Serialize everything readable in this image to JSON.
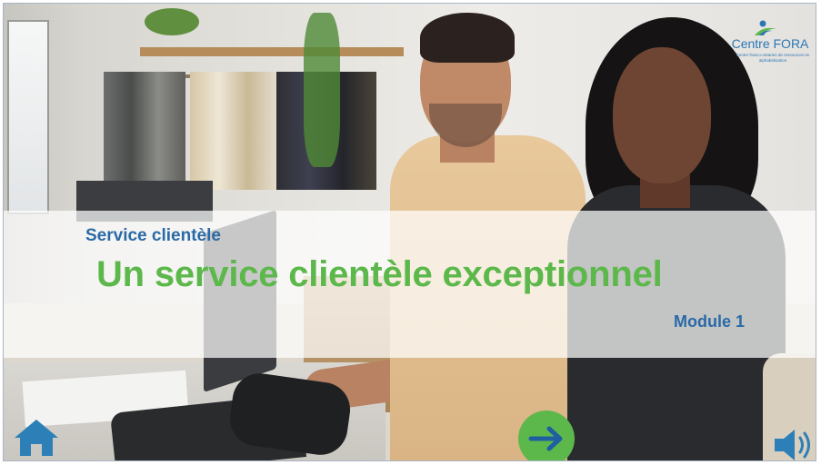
{
  "slide": {
    "category": "Service clientèle",
    "title": "Un service clientèle exceptionnel",
    "module": "Module 1"
  },
  "logo": {
    "name": "Centre FORA",
    "tagline": "Centre franco-ontarien de ressources en alphabétisation",
    "icon": "person-figure-icon"
  },
  "controls": {
    "home_icon": "home-icon",
    "next_icon": "arrow-right-icon",
    "audio_icon": "speaker-icon"
  },
  "colors": {
    "title_green": "#5db84b",
    "label_blue": "#2a6aa6",
    "button_green": "#5db84b",
    "icon_blue": "#2d7fb8"
  }
}
